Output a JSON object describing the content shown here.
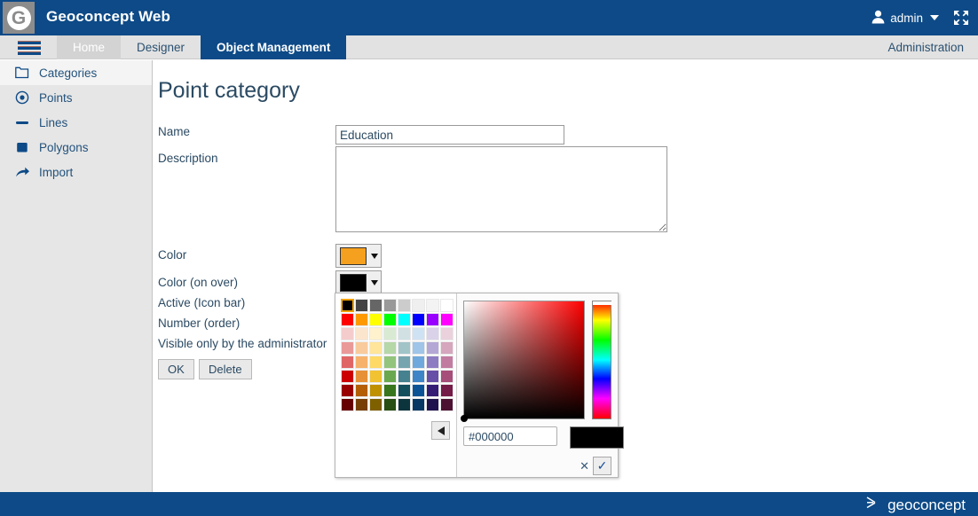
{
  "topbar": {
    "app_title": "Geoconcept Web",
    "user_name": "admin",
    "user_icon": "user-icon",
    "caret_icon": "chevron-down-icon",
    "expand_icon": "expand-arrows-icon",
    "brand_color": "#0d4a87"
  },
  "tabbar": {
    "menu_icon": "hamburger-menu-icon",
    "tabs": [
      {
        "label": "Home",
        "state": "light"
      },
      {
        "label": "Designer",
        "state": "normal"
      },
      {
        "label": "Object Management",
        "state": "active"
      }
    ],
    "admin_link": "Administration"
  },
  "sidebar": {
    "items": [
      {
        "label": "Categories",
        "icon": "folder-icon",
        "selected": true
      },
      {
        "label": "Points",
        "icon": "point-target-icon",
        "selected": false
      },
      {
        "label": "Lines",
        "icon": "line-icon",
        "selected": false
      },
      {
        "label": "Polygons",
        "icon": "polygon-square-icon",
        "selected": false
      },
      {
        "label": "Import",
        "icon": "import-arrow-icon",
        "selected": false
      }
    ]
  },
  "main": {
    "page_title": "Point category",
    "fields": {
      "name_label": "Name",
      "name_value": "Education",
      "description_label": "Description",
      "description_value": "",
      "color_label": "Color",
      "color_value": "#F5A01E",
      "color_over_label": "Color (on over)",
      "color_over_value": "#000000",
      "active_label": "Active (Icon bar)",
      "number_label": "Number (order)",
      "visible_admin_label": "Visible only by the administrator"
    },
    "buttons": {
      "ok": "OK",
      "delete": "Delete"
    }
  },
  "color_picker": {
    "hex_value": "#000000",
    "preview_color": "#000000",
    "selected_swatch_index": 0,
    "back_icon": "triangle-left-icon",
    "cancel_icon": "close-x-icon",
    "confirm_icon": "checkmark-icon",
    "palette": [
      [
        "#000000",
        "#434343",
        "#666666",
        "#999999",
        "#cccccc",
        "#efefef",
        "#f3f3f3",
        "#ffffff"
      ],
      [
        "#ff0000",
        "#ff9900",
        "#ffff00",
        "#00ff00",
        "#00ffff",
        "#0000ff",
        "#9900ff",
        "#ff00ff"
      ],
      [
        "#f4cccc",
        "#fce5cd",
        "#fff2cc",
        "#d9ead3",
        "#d0e0e3",
        "#cfe2f3",
        "#d9d2e9",
        "#ead1dc"
      ],
      [
        "#ea9999",
        "#f9cb9c",
        "#ffe599",
        "#b6d7a8",
        "#a2c4c9",
        "#9fc5e8",
        "#b4a7d6",
        "#d5a6bd"
      ],
      [
        "#e06666",
        "#f6b26b",
        "#ffd966",
        "#93c47d",
        "#76a5af",
        "#6fa8dc",
        "#8e7cc3",
        "#c27ba0"
      ],
      [
        "#cc0000",
        "#e69138",
        "#f1c232",
        "#6aa84f",
        "#45818e",
        "#3d85c6",
        "#674ea7",
        "#a64d79"
      ],
      [
        "#990000",
        "#b45f06",
        "#bf9000",
        "#38761d",
        "#134f5c",
        "#0b5394",
        "#351c75",
        "#741b47"
      ],
      [
        "#660000",
        "#783f04",
        "#7f6000",
        "#274e13",
        "#0c343d",
        "#073763",
        "#20124d",
        "#4c1130"
      ]
    ]
  },
  "footer": {
    "brand_text": "geoconcept",
    "brand_icon": "geoconcept-arrow-icon"
  }
}
